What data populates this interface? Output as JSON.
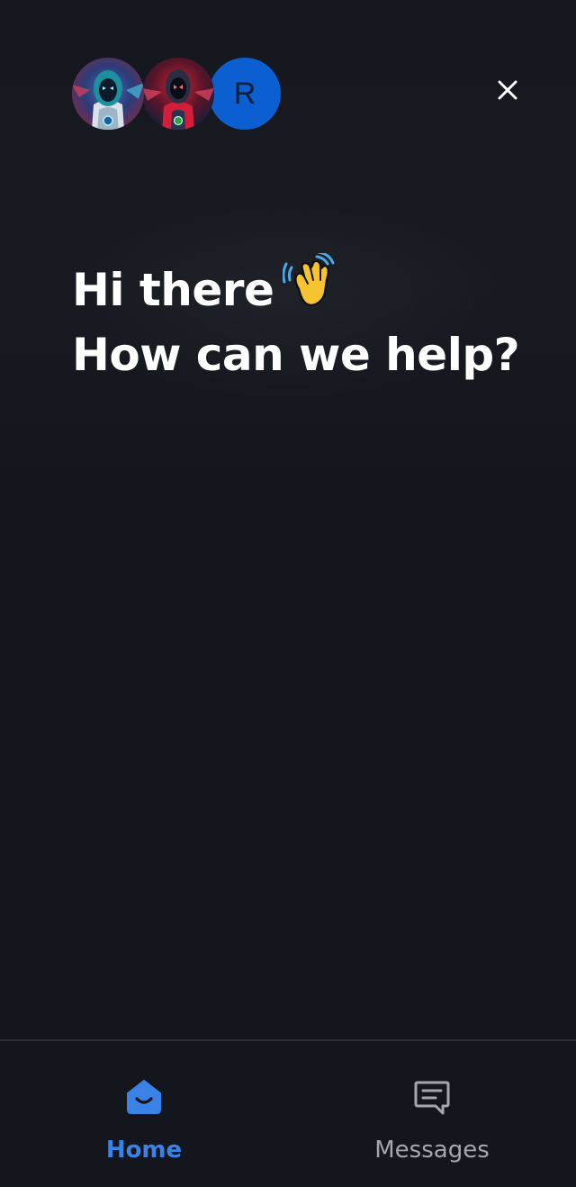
{
  "header": {
    "avatars": [
      {
        "type": "image",
        "icon": "robot-avatar-teal"
      },
      {
        "type": "image",
        "icon": "robot-avatar-red"
      },
      {
        "type": "initial",
        "initial": "R",
        "color": "#0b5fd0"
      }
    ],
    "close_icon": "close-icon"
  },
  "greeting": {
    "line1": "Hi there",
    "emoji": "waving-hand-icon",
    "line2": "How can we help?"
  },
  "bottom_nav": {
    "items": [
      {
        "label": "Home",
        "icon": "home-icon",
        "active": true,
        "color": "#3b82e6"
      },
      {
        "label": "Messages",
        "icon": "messages-icon",
        "active": false,
        "color": "#a4a7ae"
      }
    ]
  },
  "colors": {
    "background": "#14161d",
    "accent": "#3b82e6",
    "divider": "#2c2f38"
  }
}
